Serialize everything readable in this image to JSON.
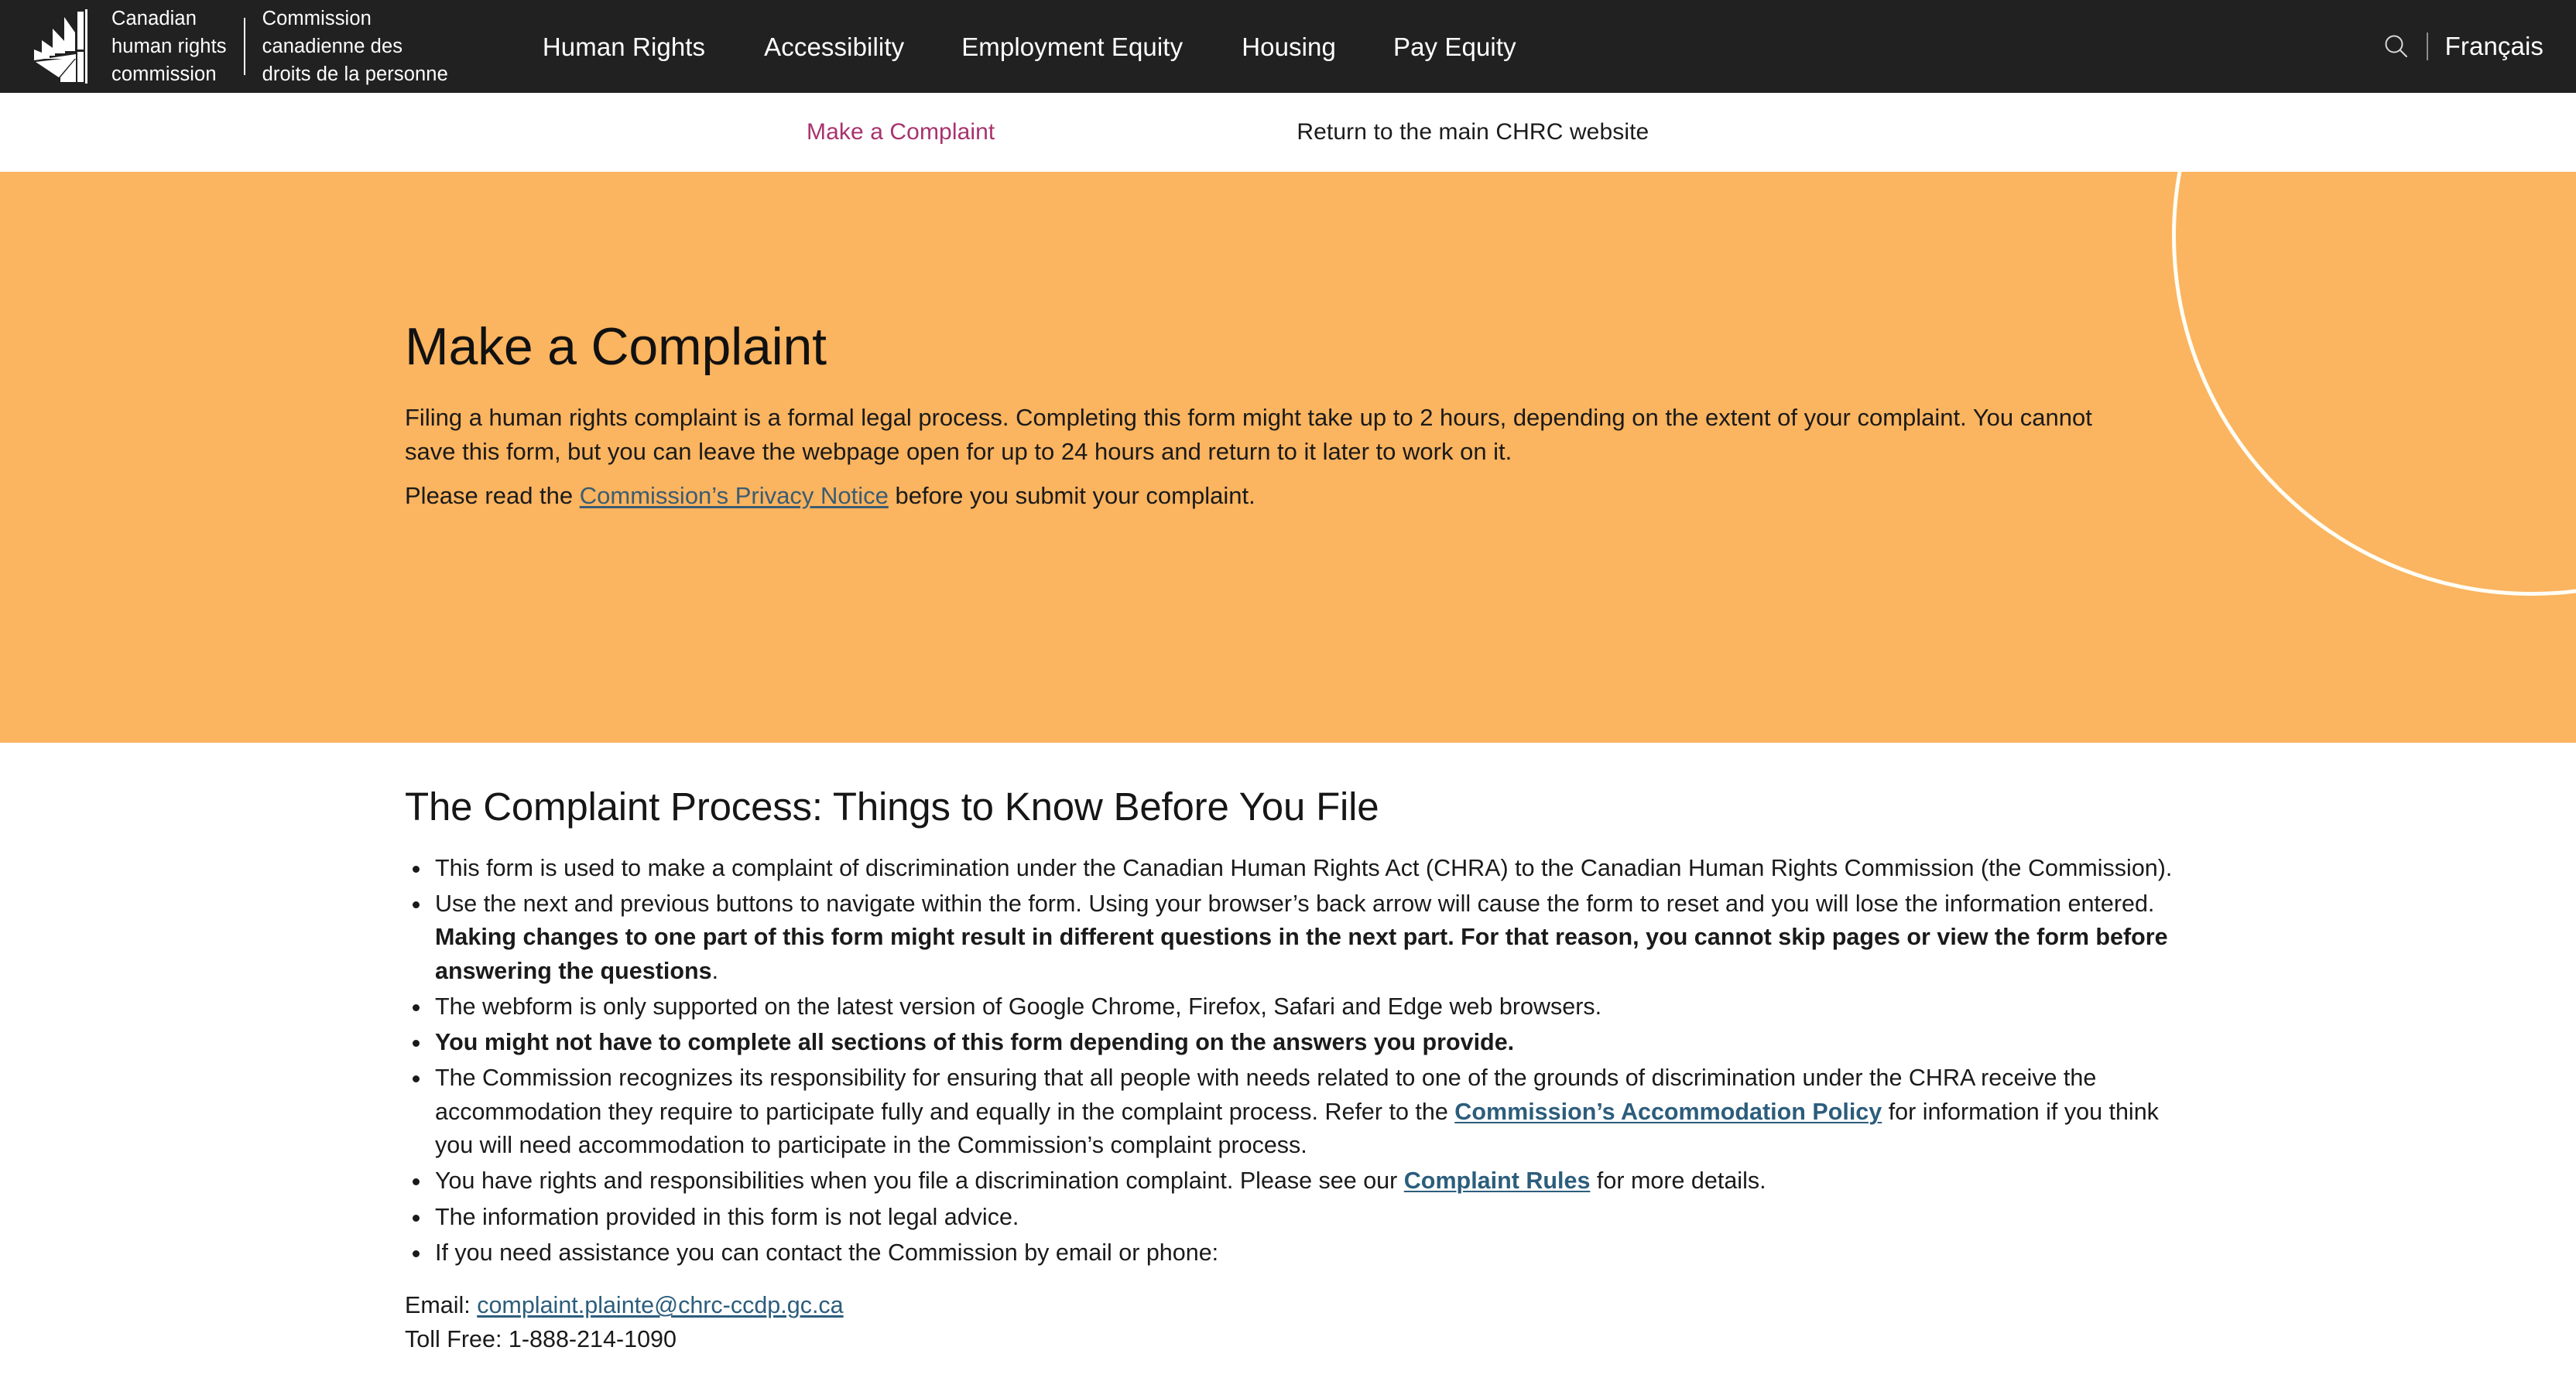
{
  "header": {
    "logo": {
      "icon": "chrc-maple-leaf-logo",
      "en_line1": "Canadian",
      "en_line2": "human rights",
      "en_line3": "commission",
      "fr_line1": "Commission",
      "fr_line2": "canadienne des",
      "fr_line3": "droits de la personne"
    },
    "nav": [
      {
        "label": "Human Rights"
      },
      {
        "label": "Accessibility"
      },
      {
        "label": "Employment Equity"
      },
      {
        "label": "Housing"
      },
      {
        "label": "Pay Equity"
      }
    ],
    "search_icon": "search-icon",
    "language_toggle": "Français",
    "background_color": "#212121"
  },
  "subnav": {
    "items": [
      {
        "label": "Make a Complaint",
        "active": true,
        "color": "#A8326E"
      },
      {
        "label": "Return to the main CHRC website",
        "active": false,
        "color": "#1c1c1c"
      }
    ]
  },
  "hero": {
    "background_color": "#FBB45F",
    "circle_color": "#FFFDF5",
    "title": "Make a Complaint",
    "paragraph_1": "Filing a human rights complaint is a formal legal process. Completing this form might take up to 2 hours, depending on the extent of your complaint. You cannot save this form, but you can leave the webpage open for up to 24 hours and return to it later to work on it.",
    "privacy_prefix": "Please read the ",
    "privacy_link": "Commission’s Privacy Notice",
    "privacy_suffix": " before you submit your complaint.",
    "link_color": "#3B5C72"
  },
  "main": {
    "heading": "The Complaint Process: Things to Know Before You File",
    "link_color": "#2C5D7C",
    "bullets": [
      {
        "parts": [
          {
            "type": "text",
            "value": "This form is used to make a complaint of discrimination under the Canadian Human Rights Act (CHRA) to the Canadian Human Rights Commission (the Commission)."
          }
        ]
      },
      {
        "parts": [
          {
            "type": "text",
            "value": "Use the next and previous buttons to navigate within the form. Using your browser’s back arrow will cause the form to reset and you will lose the information entered. "
          },
          {
            "type": "bold",
            "value": "Making changes to one part of this form might result in different questions in the next part. For that reason, you cannot skip pages or view the form before answering the questions"
          },
          {
            "type": "text",
            "value": "."
          }
        ]
      },
      {
        "parts": [
          {
            "type": "text",
            "value": "The webform is only supported on the latest version of Google Chrome, Firefox, Safari and Edge web browsers."
          }
        ]
      },
      {
        "parts": [
          {
            "type": "bold",
            "value": "You might not have to complete all sections of this form depending on the answers you provide."
          }
        ]
      },
      {
        "parts": [
          {
            "type": "text",
            "value": "The Commission recognizes its responsibility for ensuring that all people with needs related to one of the grounds of discrimination under the CHRA receive the accommodation they require to participate fully and equally in the complaint process. Refer to the "
          },
          {
            "type": "link",
            "value": "Commission’s Accommodation Policy"
          },
          {
            "type": "text",
            "value": " for information if you think you will need accommodation to participate in the Commission’s complaint process."
          }
        ]
      },
      {
        "parts": [
          {
            "type": "text",
            "value": "You have rights and responsibilities when you file a discrimination complaint. Please see our "
          },
          {
            "type": "link",
            "value": "Complaint Rules"
          },
          {
            "type": "text",
            "value": " for more details."
          }
        ]
      },
      {
        "parts": [
          {
            "type": "text",
            "value": "The information provided in this form is not legal advice."
          }
        ]
      },
      {
        "parts": [
          {
            "type": "text",
            "value": "If you need assistance you can contact the Commission by email or phone:"
          }
        ]
      }
    ],
    "contact": {
      "email_label": "Email: ",
      "email_value": "complaint.plainte@chrc-ccdp.gc.ca",
      "phone_line": "Toll Free: 1-888-214-1090"
    }
  }
}
